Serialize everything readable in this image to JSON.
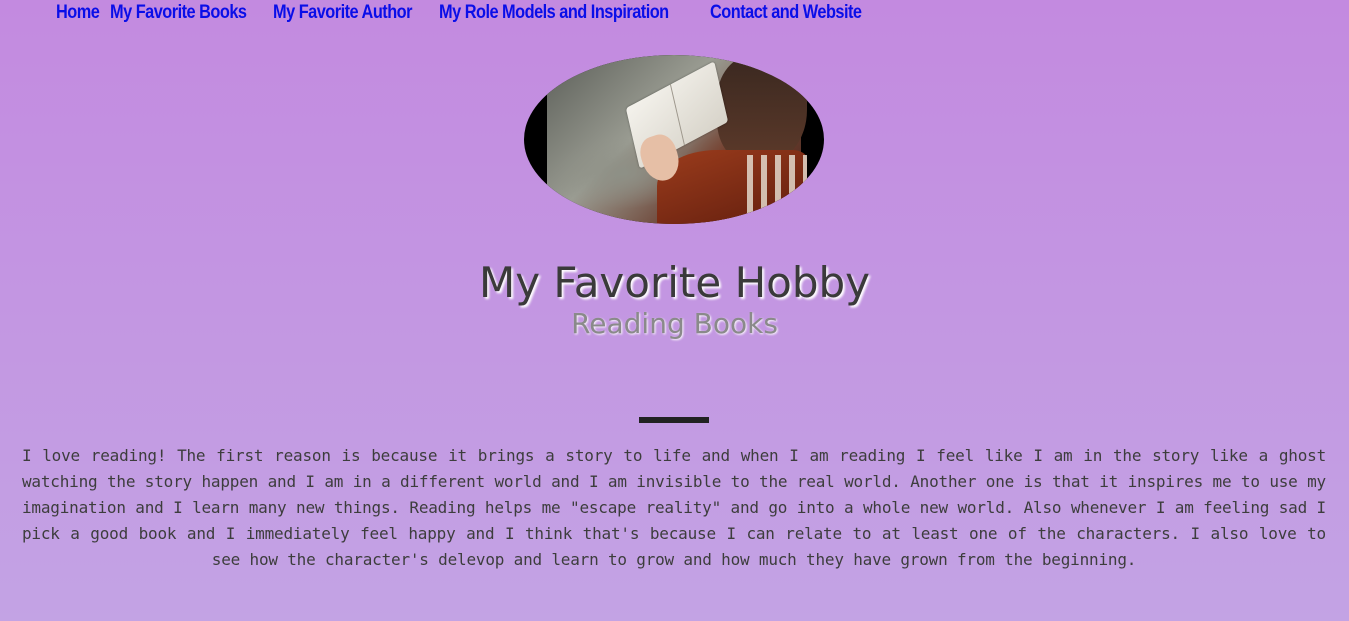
{
  "nav": {
    "items": [
      {
        "label": "Home"
      },
      {
        "label": "My Favorite Books"
      },
      {
        "label": "My Favorite Author"
      },
      {
        "label": "My Role Models and Inspiration"
      },
      {
        "label": "Contact and Website"
      }
    ]
  },
  "hero": {
    "image_alt": "woman-reading-book-image"
  },
  "heading": {
    "title": "My Favorite Hobby",
    "subtitle": "Reading Books"
  },
  "content": {
    "paragraph": "I love reading! The first reason is because it brings a story to life and when I am reading I feel like I am in the story like a ghost watching the story happen and I am in a different world and I am invisible to the real world. Another one is that it inspires me to use my imagination and I learn many new things. Reading helps me \"escape reality\" and go into a whole new world. Also whenever I am feeling sad I pick a good book and I immediately feel happy and I think that's because I can relate to at least one of the characters. I also love to see how the character's delevop and learn to grow and how much they have grown from the beginning."
  },
  "colors": {
    "nav_link": "#0a0ee8",
    "background_top": "#c38ae0",
    "background_bottom": "#c3a3e4",
    "divider": "#222222"
  }
}
